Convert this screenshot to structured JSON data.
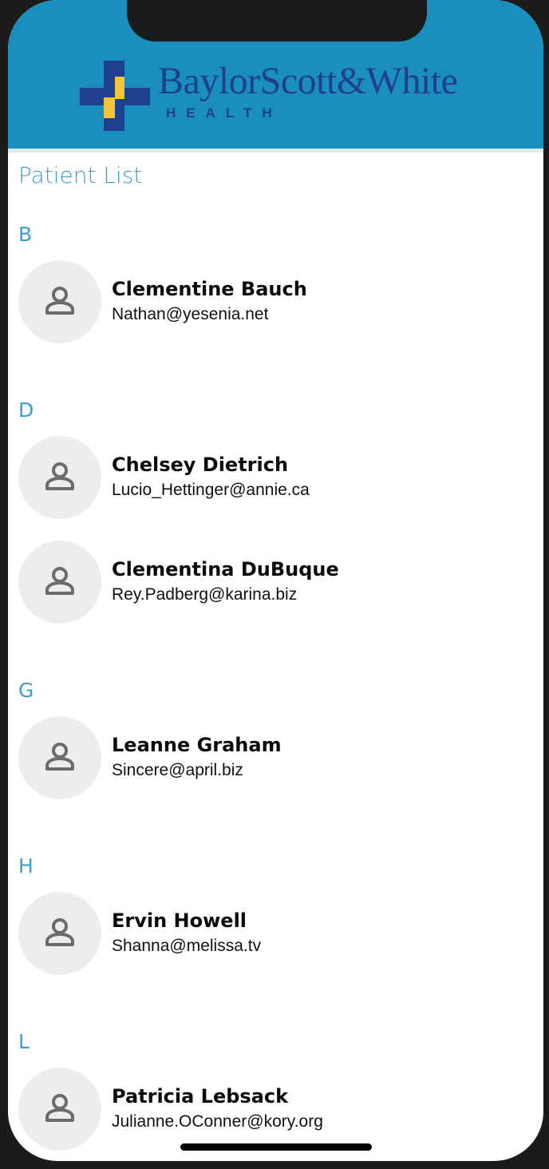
{
  "header": {
    "brand_name": "BaylorScott&White",
    "brand_sub": "HEALTH",
    "colors": {
      "header_bg": "#1a8fbd",
      "brand_blue": "#1f3f8f",
      "brand_yellow": "#f2c33d"
    }
  },
  "page": {
    "title": "Patient List",
    "accent_color": "#3aa0d0"
  },
  "sections": [
    {
      "letter": "B",
      "patients": [
        {
          "name": "Clementine Bauch",
          "email": "Nathan@yesenia.net",
          "icon": "person-icon"
        }
      ]
    },
    {
      "letter": "D",
      "patients": [
        {
          "name": "Chelsey Dietrich",
          "email": "Lucio_Hettinger@annie.ca",
          "icon": "person-icon"
        },
        {
          "name": "Clementina DuBuque",
          "email": "Rey.Padberg@karina.biz",
          "icon": "person-icon"
        }
      ]
    },
    {
      "letter": "G",
      "patients": [
        {
          "name": "Leanne Graham",
          "email": "Sincere@april.biz",
          "icon": "person-icon"
        }
      ]
    },
    {
      "letter": "H",
      "patients": [
        {
          "name": "Ervin Howell",
          "email": "Shanna@melissa.tv",
          "icon": "person-icon"
        }
      ]
    },
    {
      "letter": "L",
      "patients": [
        {
          "name": "Patricia Lebsack",
          "email": "Julianne.OConner@kory.org",
          "icon": "person-icon"
        }
      ]
    }
  ]
}
